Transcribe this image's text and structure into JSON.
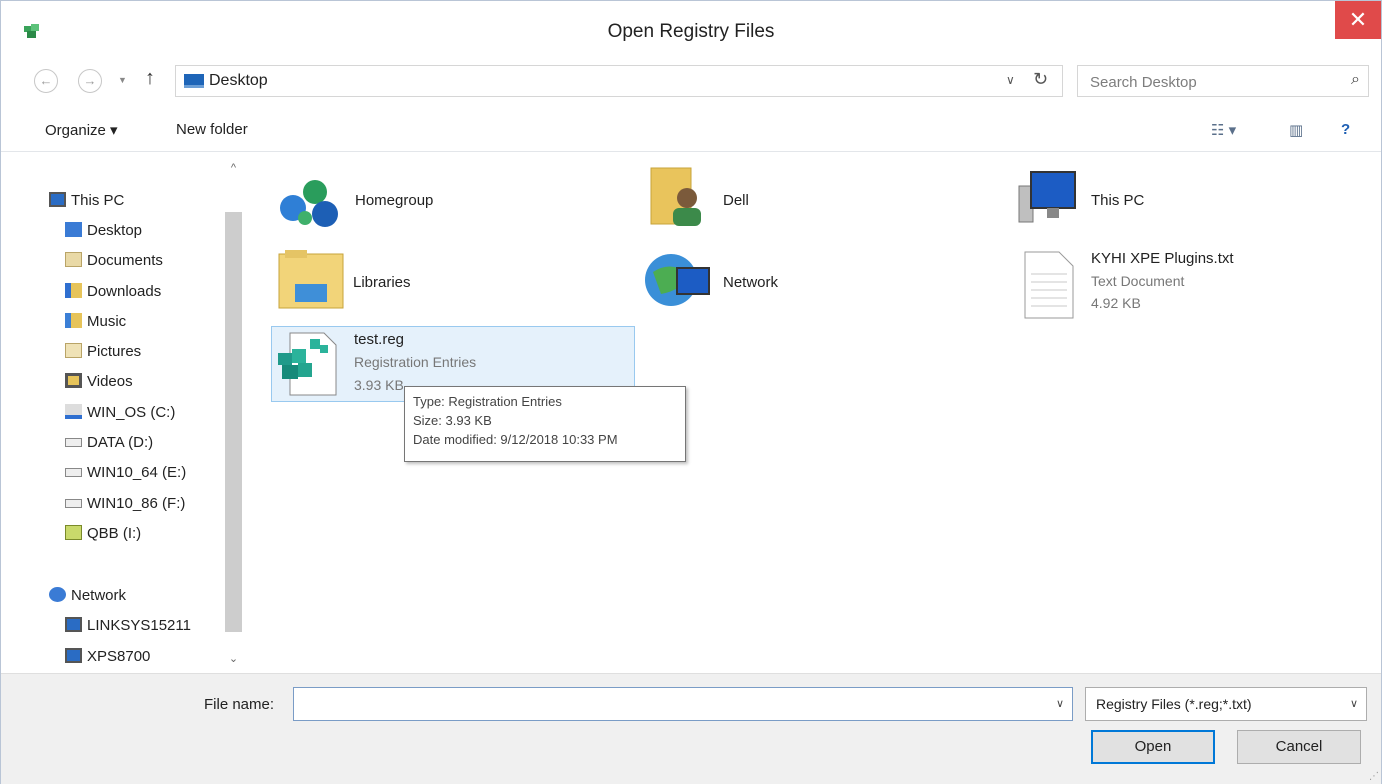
{
  "window": {
    "title": "Open Registry Files",
    "close_glyph": "✕"
  },
  "address": {
    "path": "Desktop",
    "search_placeholder": "Search Desktop"
  },
  "toolbar": {
    "organize_label": "Organize ▾",
    "new_folder_label": "New folder"
  },
  "nav": {
    "this_pc": "This PC",
    "items": [
      "Desktop",
      "Documents",
      "Downloads",
      "Music",
      "Pictures",
      "Videos",
      "WIN_OS (C:)",
      "DATA (D:)",
      "WIN10_64 (E:)",
      "WIN10_86 (F:)",
      "QBB (I:)"
    ],
    "network": "Network",
    "network_items": [
      "LINKSYS15211",
      "XPS8700"
    ]
  },
  "content": {
    "homegroup": "Homegroup",
    "dell": "Dell",
    "this_pc": "This PC",
    "libraries": "Libraries",
    "network": "Network",
    "kyhi": {
      "name": "KYHI XPE Plugins.txt",
      "type": "Text Document",
      "size": "4.92 KB"
    },
    "testreg": {
      "name": "test.reg",
      "type": "Registration Entries",
      "size": "3.93 KB"
    }
  },
  "tooltip": {
    "type": "Type: Registration Entries",
    "size": "Size: 3.93 KB",
    "modified": "Date modified: 9/12/2018 10:33 PM"
  },
  "bottom": {
    "file_name_label": "File name:",
    "file_name_value": "",
    "filter_value": "Registry Files (*.reg;*.txt)",
    "open_label": "Open",
    "cancel_label": "Cancel"
  }
}
